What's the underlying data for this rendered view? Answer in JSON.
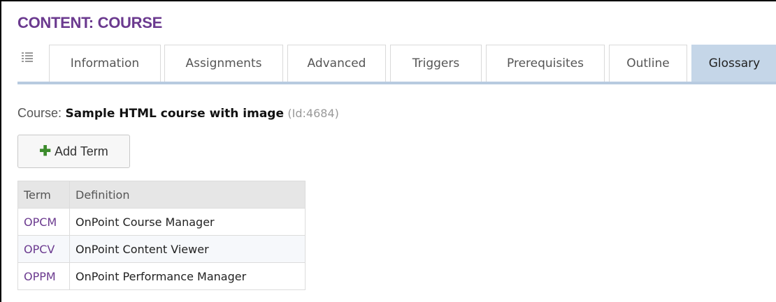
{
  "page": {
    "title": "CONTENT: COURSE"
  },
  "tabs": [
    {
      "label": "Information",
      "active": false
    },
    {
      "label": "Assignments",
      "active": false
    },
    {
      "label": "Advanced",
      "active": false
    },
    {
      "label": "Triggers",
      "active": false
    },
    {
      "label": "Prerequisites",
      "active": false
    },
    {
      "label": "Outline",
      "active": false
    },
    {
      "label": "Glossary",
      "active": true
    }
  ],
  "course": {
    "prefix": "Course:",
    "name": "Sample HTML course with image",
    "id_text": "(Id:4684)"
  },
  "toolbar": {
    "add_term_label": "Add Term",
    "add_term_icon": "plus-icon"
  },
  "glossary": {
    "columns": [
      "Term",
      "Definition"
    ],
    "rows": [
      {
        "term": "OPCM",
        "definition": "OnPoint Course Manager"
      },
      {
        "term": "OPCV",
        "definition": "OnPoint Content Viewer"
      },
      {
        "term": "OPPM",
        "definition": "OnPoint Performance Manager"
      }
    ]
  },
  "colors": {
    "title": "#6b3a8f",
    "active_tab": "#c5d6e8",
    "tab_underline": "#b8cbe0",
    "term_link": "#6b3a8f",
    "add_icon": "#3c8b2c"
  }
}
